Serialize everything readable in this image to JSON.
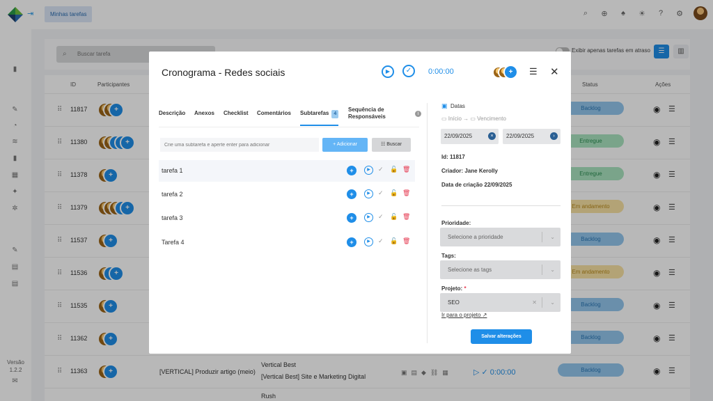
{
  "app": {
    "breadcrumb": "Minhas tarefas",
    "version_label": "Versão",
    "version_number": "1.2.2"
  },
  "filters": {
    "search_placeholder": "Buscar tarefa",
    "late_toggle_label": "Exibir apenas tarefas em atraso"
  },
  "list": {
    "headers": {
      "id": "ID",
      "participants": "Participantes",
      "status": "Status",
      "actions": "Ações"
    },
    "rows": [
      {
        "id": "11817",
        "avatars": [
          "photo",
          "photo",
          "blue"
        ],
        "status": "Backlog",
        "status_type": "backlog"
      },
      {
        "id": "11380",
        "avatars": [
          "photo",
          "photo",
          "blue",
          "blue",
          "blue"
        ],
        "status": "Entregue",
        "status_type": "entregue"
      },
      {
        "id": "11378",
        "avatars": [
          "photo",
          "blue"
        ],
        "status": "Entregue",
        "status_type": "entregue"
      },
      {
        "id": "11379",
        "avatars": [
          "photo",
          "photo",
          "photo",
          "blue",
          "blue"
        ],
        "status": "Em andamento",
        "status_type": "andamento"
      },
      {
        "id": "11537",
        "avatars": [
          "photo",
          "blue"
        ],
        "status": "Backlog",
        "status_type": "backlog"
      },
      {
        "id": "11536",
        "avatars": [
          "photo",
          "blue",
          "blue"
        ],
        "status": "Em andamento",
        "status_type": "andamento"
      },
      {
        "id": "11535",
        "avatars": [
          "photo",
          "blue"
        ],
        "status": "Backlog",
        "status_type": "backlog"
      },
      {
        "id": "11362",
        "avatars": [
          "photo",
          "blue"
        ],
        "status": "Backlog",
        "status_type": "backlog"
      },
      {
        "id": "11363",
        "avatars": [
          "photo",
          "blue"
        ],
        "status": "Backlog",
        "status_type": "backlog",
        "title": "[VERTICAL] Produzir artigo (meio)",
        "project_client": "Vertical Best",
        "project_name": "[Vertical Best] Site e Marketing Digital",
        "timer": "0:00:00"
      }
    ],
    "partial_row_client": "Rush"
  },
  "modal": {
    "title": "Cronograma - Redes sociais",
    "timer": "0:00:00",
    "tabs": [
      {
        "label": "Descrição"
      },
      {
        "label": "Anexos"
      },
      {
        "label": "Checklist"
      },
      {
        "label": "Comentários"
      },
      {
        "label": "Subtarefas",
        "badge": "4",
        "active": true
      },
      {
        "label": "Sequência de Responsáveis"
      }
    ],
    "subtask_input_placeholder": "Crie uma subtarefa e aperte enter para adicionar",
    "add_button": "Adicionar",
    "search_button": "Buscar",
    "subtasks": [
      {
        "title": "tarefa 1"
      },
      {
        "title": "tarefa 2"
      },
      {
        "title": "tarefa 3"
      },
      {
        "title": "Tarefa 4"
      }
    ],
    "details": {
      "dates_title": "Datas",
      "start_label": "Início",
      "due_label": "Vencimento",
      "start_date": "22/09/2025",
      "due_date": "22/09/2025",
      "id_label": "Id:",
      "id_value": "11817",
      "creator_label": "Criador:",
      "creator_value": "Jane Kerolly",
      "created_label": "Data de criação",
      "created_value": "22/09/2025",
      "priority_label": "Prioridade:",
      "priority_placeholder": "Selecione a prioridade",
      "tags_label": "Tags:",
      "tags_placeholder": "Selecione as tags",
      "project_label": "Projeto:",
      "project_required": "*",
      "project_value": "SEO",
      "project_link": "Ir para o projeto",
      "save_button": "Salvar alterações"
    }
  },
  "colors": {
    "accent": "#1f8ee8",
    "danger": "#e53950"
  }
}
